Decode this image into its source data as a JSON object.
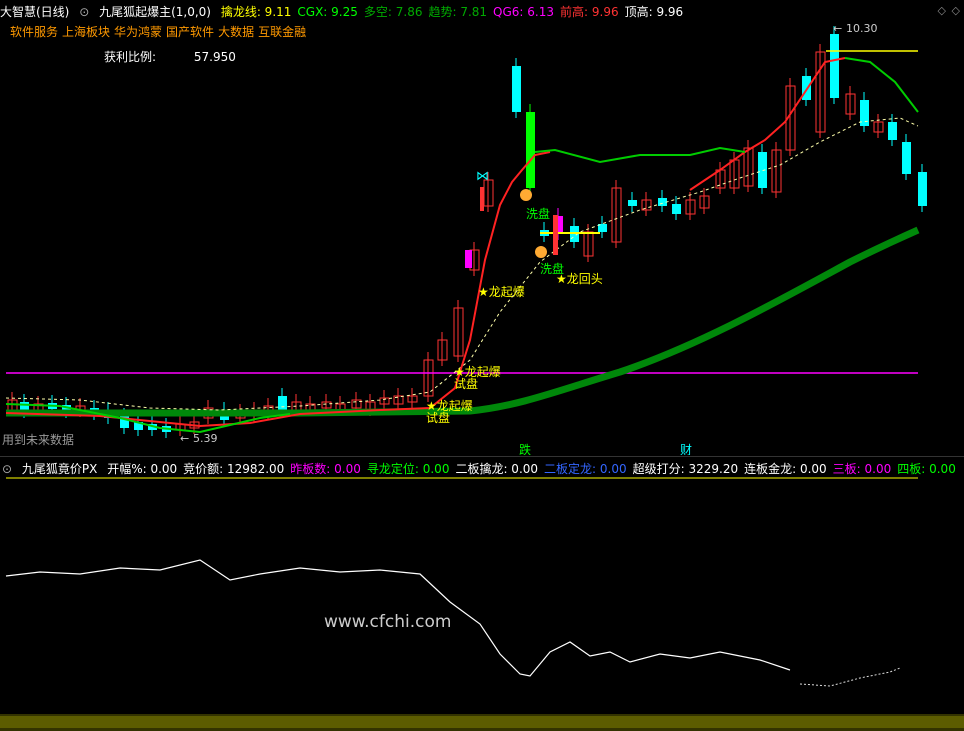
{
  "main": {
    "title": "大智慧(日线)",
    "indicator_name": "九尾狐起爆主(1,0,0)",
    "values": [
      {
        "label": "擒龙线:",
        "value": "9.11",
        "color": "#ffff00"
      },
      {
        "label": "CGX:",
        "value": "9.25",
        "color": "#00ff00"
      },
      {
        "label": "多空:",
        "value": "7.86",
        "color": "#00aa00"
      },
      {
        "label": "趋势:",
        "value": "7.81",
        "color": "#00aa00"
      },
      {
        "label": "QG6:",
        "value": "6.13",
        "color": "#ff00ff"
      },
      {
        "label": "前高:",
        "value": "9.96",
        "color": "#ff3333"
      },
      {
        "label": "顶高:",
        "value": "9.96",
        "color": "#ffffff"
      }
    ],
    "sectors": [
      "软件服务",
      "上海板块",
      "华为鸿蒙",
      "国产软件",
      "大数据",
      "互联金融"
    ],
    "profit_label": "获利比例:",
    "profit_value": "57.950",
    "future_data_label": "用到未来数据",
    "high_label": "10.30",
    "low_label": "5.39",
    "annotations": {
      "long_qibao_1": "龙起爆",
      "long_qibao_2": "龙起爆",
      "long_qibao_3": "龙起爆",
      "shipan_1": "试盘",
      "shipan_2": "试盘",
      "xipan_1": "洗盘",
      "xipan_2": "洗盘",
      "long_huitou": "龙回头",
      "die": "跌",
      "cai": "财"
    }
  },
  "sub": {
    "indicator_name": "九尾狐竟价PX",
    "values": [
      {
        "label": "开幅%:",
        "value": "0.00",
        "color": "#ffffff"
      },
      {
        "label": "竞价额:",
        "value": "12982.00",
        "color": "#ffffff"
      },
      {
        "label": "昨板数:",
        "value": "0.00",
        "color": "#ff00ff"
      },
      {
        "label": "寻龙定位:",
        "value": "0.00",
        "color": "#00ff00"
      },
      {
        "label": "二板擒龙:",
        "value": "0.00",
        "color": "#ffffff"
      },
      {
        "label": "二板定龙:",
        "value": "0.00",
        "color": "#3366ff"
      },
      {
        "label": "超级打分:",
        "value": "3229.20",
        "color": "#ffffff"
      },
      {
        "label": "连板金龙:",
        "value": "0.00",
        "color": "#ffffff"
      },
      {
        "label": "三板:",
        "value": "0.00",
        "color": "#ff00ff"
      },
      {
        "label": "四板:",
        "value": "0.00",
        "color": "#00ff00"
      }
    ],
    "watermark": "www.cfchi.com"
  },
  "colors": {
    "up": "#ff3333",
    "down": "#00ffff",
    "ma_green": "#00cc00",
    "trend_green": "#008800",
    "magenta_line": "#ff00ff",
    "yellow": "#ffff00"
  },
  "icons": {
    "gear": "gear-icon",
    "diamond": "diamond-icon",
    "close": "close-icon"
  }
}
